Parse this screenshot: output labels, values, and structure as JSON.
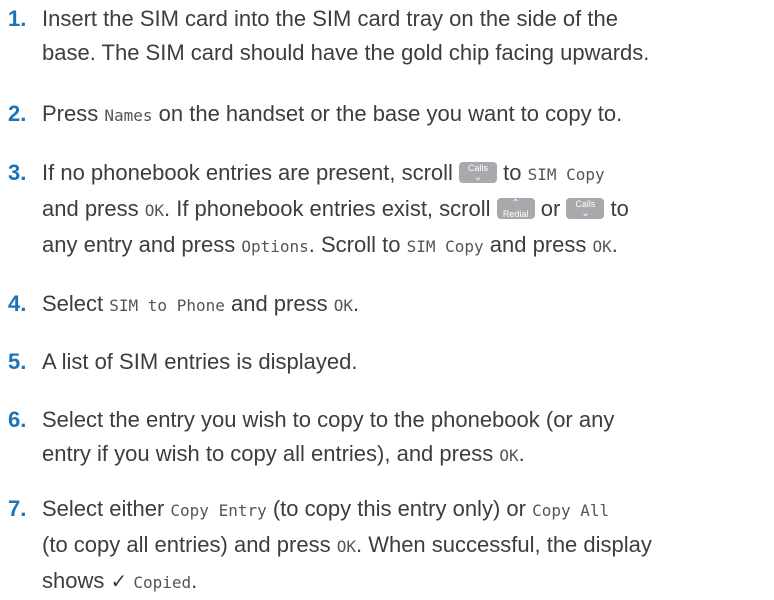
{
  "steps": [
    {
      "num": "1.",
      "lines": [
        "Insert the SIM card into the SIM card tray on the side of the",
        "base. The SIM card should have the gold chip facing upwards."
      ]
    },
    {
      "num": "2.",
      "a": "Press ",
      "names": "Names",
      "b": " on the handset or the base you want to copy to."
    },
    {
      "num": "3.",
      "l1a": "If no phonebook entries are present, scroll ",
      "l1b": " to ",
      "sim_copy": "SIM Copy",
      "l2a": "and press ",
      "ok": "OK",
      "l2b": ". If phonebook entries exist, scroll ",
      "l2c": " or ",
      "l2d": " to",
      "l3a": "any entry and press ",
      "options": "Options",
      "l3b": ". Scroll to ",
      "l3c": " and press ",
      "l3d": "."
    },
    {
      "num": "4.",
      "a": "Select ",
      "sim_to_phone": "SIM to Phone",
      "b": " and press ",
      "ok": "OK",
      "c": "."
    },
    {
      "num": "5.",
      "text": "A list of SIM entries is displayed."
    },
    {
      "num": "6.",
      "l1": "Select the entry you wish to copy to the phonebook (or any",
      "l2a": "entry if you wish to copy all entries), and press ",
      "ok": "OK",
      "l2b": "."
    },
    {
      "num": "7.",
      "l1a": "Select either ",
      "copy_entry": "Copy Entry",
      "l1b": " (to copy this entry only) or ",
      "copy_all": "Copy All",
      "l2a": "(to copy all entries) and press ",
      "ok": "OK",
      "l2b": ". When successful, the display",
      "l3a": "shows ",
      "check": "✓",
      "copied": "Copied",
      "l3b": "."
    }
  ],
  "keys": {
    "calls_label": "Calls",
    "redial_label": "Redial",
    "down_arrow": "⌄",
    "up_arrow": "⌃",
    "key_color": "#a7a9ac"
  },
  "colors": {
    "number": "#1e72b6",
    "text": "#3d3d3d"
  }
}
